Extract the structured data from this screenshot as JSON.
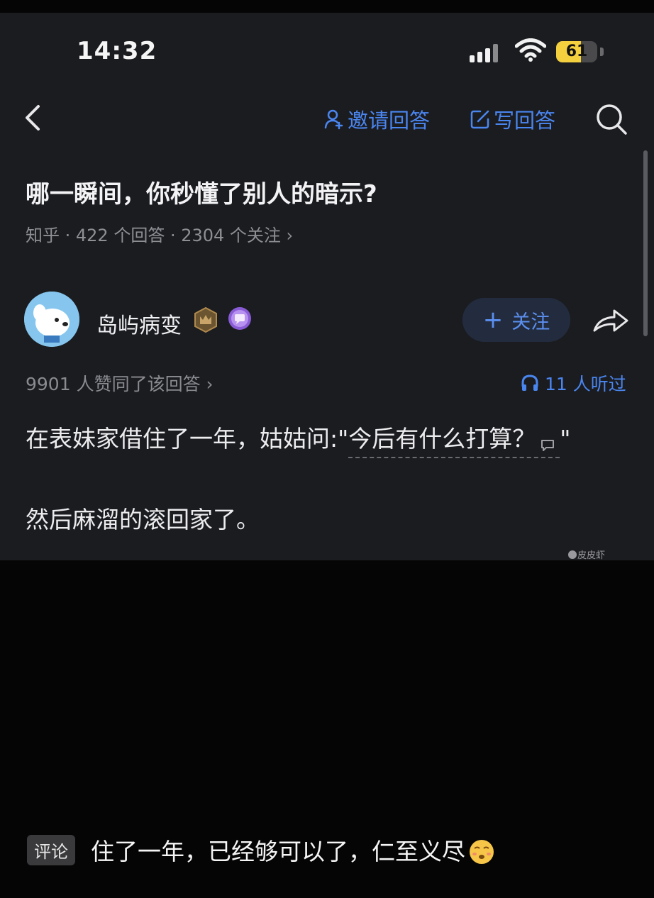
{
  "status_bar": {
    "time": "14:32",
    "battery": "61",
    "battery_level": 0.61
  },
  "nav": {
    "invite_label": "邀请回答",
    "write_label": "写回答"
  },
  "question": {
    "title": "哪一瞬间，你秒懂了别人的暗示?",
    "meta": "知乎 · 422 个回答 · 2304 个关注 ›"
  },
  "author": {
    "name": "岛屿病变",
    "follow_label": "关注"
  },
  "stats": {
    "approve": "9901 人赞同了该回答 ›",
    "listen": "11 人听过"
  },
  "answer": {
    "line1_prefix": "在表妹家借住了一年，姑姑问:\"",
    "line1_quote": "今后有什么打算？",
    "line1_suffix": "\"",
    "line2": "然后麻溜的滚回家了。"
  },
  "watermark": "皮皮虾",
  "caption": {
    "tag": "评论",
    "text": "住了一年，已经够可以了，仁至义尽"
  },
  "colors": {
    "accent": "#4a86f0",
    "background": "#1b1c20"
  },
  "icons": [
    "back-icon",
    "invite-user-icon",
    "edit-icon",
    "search-icon",
    "crown-badge-icon",
    "speech-badge-icon",
    "share-icon",
    "headphones-icon",
    "comment-icon",
    "emoji-icon"
  ]
}
